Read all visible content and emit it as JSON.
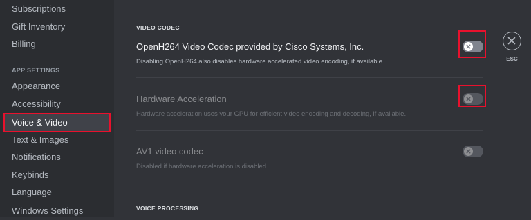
{
  "sidebar": {
    "items_top": [
      {
        "label": "Subscriptions"
      },
      {
        "label": "Gift Inventory"
      },
      {
        "label": "Billing"
      }
    ],
    "app_settings_header": "APP SETTINGS",
    "app_items": [
      {
        "label": "Appearance"
      },
      {
        "label": "Accessibility"
      },
      {
        "label": "Voice & Video",
        "selected": true
      },
      {
        "label": "Text & Images"
      },
      {
        "label": "Notifications"
      },
      {
        "label": "Keybinds"
      },
      {
        "label": "Language"
      },
      {
        "label": "Windows Settings"
      }
    ]
  },
  "main": {
    "video_codec_header": "VIDEO CODEC",
    "options": [
      {
        "title": "OpenH264 Video Codec provided by Cisco Systems, Inc.",
        "description": "Disabling OpenH264 also disables hardware accelerated video encoding, if available.",
        "enabled": false,
        "disabled": false
      },
      {
        "title": "Hardware Acceleration",
        "description": "Hardware acceleration uses your GPU for efficient video encoding and decoding, if available.",
        "enabled": false,
        "disabled": true
      },
      {
        "title": "AV1 video codec",
        "description": "Disabled if hardware acceleration is disabled.",
        "enabled": false,
        "disabled": true
      }
    ],
    "voice_processing_header": "VOICE PROCESSING"
  },
  "close": {
    "icon": "close-icon",
    "label": "ESC"
  },
  "colors": {
    "background": "#313338",
    "sidebar": "#2b2d31",
    "selected_item": "#404249",
    "toggle_off": "#80848e",
    "highlight_box": "#e8112d"
  }
}
